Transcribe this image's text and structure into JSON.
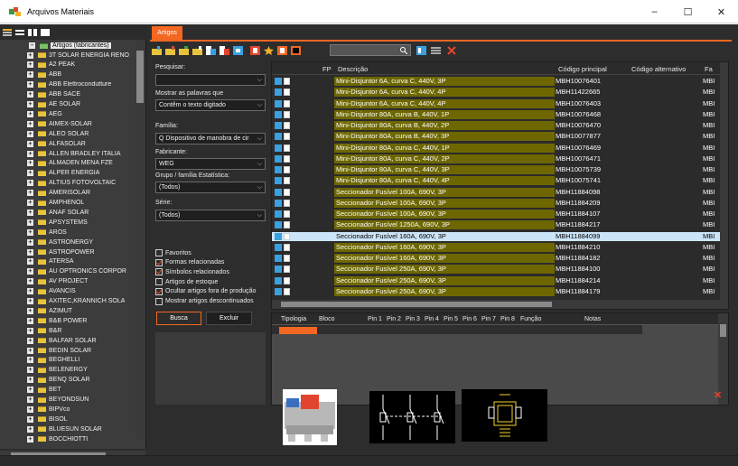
{
  "window": {
    "title": "Arquivos Materiais",
    "minimize": "–",
    "maximize": "☐",
    "close": "✕"
  },
  "tree": {
    "root_label": "Artigos (fabricantes)",
    "items": [
      "3T SOLAR ENERGIA RENO",
      "A2 PEAK",
      "ABB",
      "ABB Elettrocondutture",
      "ABB SACE",
      "AE SOLAR",
      "AEG",
      "AIMEX-SOLAR",
      "ALEO SOLAR",
      "ALFASOLAR",
      "ALLEN BRADLEY ITALIA",
      "ALMADEN MENA FZE",
      "ALPER ENERGIA",
      "ALTIUS FOTOVOLTAIC",
      "AMERISOLAR",
      "AMPHENOL",
      "ANAF SOLAR",
      "APSYSTEMS",
      "AROS",
      "ASTRONERGY",
      "ASTROPOWER",
      "ATERSA",
      "AU OPTRONICS CORPOR",
      "AV PROJECT",
      "AVANCIS",
      "AXITEC,KRANNICH SOLA",
      "AZIMUT",
      "B&B POWER",
      "B&R",
      "BALFAR SOLAR",
      "BEDIN SOLAR",
      "BEGHELLI",
      "BELENERGY",
      "BENQ SOLAR",
      "BET",
      "BEYONDSUN",
      "BIPVco",
      "BISOL",
      "BLUESUN SOLAR",
      "BOCCHIOTTI"
    ],
    "expand_symbol": "+",
    "collapse_symbol": "−"
  },
  "tab": {
    "label": "Artigos"
  },
  "filters": {
    "search_label": "Pesquisar:",
    "search_value": "",
    "words_label": "Mostrar as palavras que",
    "words_value": "Contêm o texto digitado",
    "family_label": "Família:",
    "family_value": "Q Dispositivo de manobra de cir",
    "maker_label": "Fabricante:",
    "maker_value": "WEG",
    "group_label": "Grupo / família Estatística:",
    "group_value": "(Todos)",
    "series_label": "Série:",
    "series_value": "(Todos)",
    "checkboxes": [
      {
        "label": "Favoritos",
        "checked": false
      },
      {
        "label": "Formas relacionadas",
        "checked": true
      },
      {
        "label": "Símbolos relacionados",
        "checked": true
      },
      {
        "label": "Artigos de estoque",
        "checked": false
      },
      {
        "label": "Ocultar artigos fora de produção",
        "checked": true
      },
      {
        "label": "Mostrar artigos descontinuados",
        "checked": false
      }
    ],
    "search_button": "Busca",
    "delete_button": "Excluir"
  },
  "grid": {
    "headers": {
      "fp": "FP",
      "desc": "Descrição",
      "code": "Código principal",
      "alt": "Código alternativo",
      "fa": "Fa"
    },
    "rows": [
      {
        "desc": "Mini-Disjuntor 6A, curva C, 440V, 3P",
        "code": "MBH10076401",
        "fa": "MBI"
      },
      {
        "desc": "Mini-Disjuntor 6A, curva C, 440V, 4P",
        "code": "MBH11422665",
        "fa": "MBI"
      },
      {
        "desc": "Mini-Disjuntor 6A, curva C, 440V, 4P",
        "code": "MBH10076403",
        "fa": "MBI"
      },
      {
        "desc": "Mini-Disjuntor 80A, curva B, 440V, 1P",
        "code": "MBH10076468",
        "fa": "MBI"
      },
      {
        "desc": "Mini-Disjuntor 80A, curva B, 440V, 2P",
        "code": "MBH10076470",
        "fa": "MBI"
      },
      {
        "desc": "Mini-Disjuntor 80A, curva B, 440V, 3P",
        "code": "MBH10077877",
        "fa": "MBI"
      },
      {
        "desc": "Mini-Disjuntor 80A, curva C, 440V, 1P",
        "code": "MBH10076469",
        "fa": "MBI"
      },
      {
        "desc": "Mini-Disjuntor 80A, curva C, 440V, 2P",
        "code": "MBH10076471",
        "fa": "MBI"
      },
      {
        "desc": "Mini-Disjuntor 80A, curva C, 440V, 3P",
        "code": "MBH10075739",
        "fa": "MBI"
      },
      {
        "desc": "Mini-Disjuntor 80A, curva C, 440V, 4P",
        "code": "MBH10075741",
        "fa": "MBI"
      },
      {
        "desc": "Seccionador Fusível 100A, 690V, 3P",
        "code": "MBH11884098",
        "fa": "MBI"
      },
      {
        "desc": "Seccionador Fusível 100A, 690V, 3P",
        "code": "MBH11884209",
        "fa": "MBI"
      },
      {
        "desc": "Seccionador Fusível 100A, 690V, 3P",
        "code": "MBH11884107",
        "fa": "MBI"
      },
      {
        "desc": "Seccionador Fusível 1250A, 690V, 3P",
        "code": "MBH11884217",
        "fa": "MBI"
      },
      {
        "desc": "Seccionador Fusível 160A, 690V, 3P",
        "code": "MBH11884099",
        "fa": "MBI",
        "selected": true
      },
      {
        "desc": "Seccionador Fusível 160A, 690V, 3P",
        "code": "MBH11884210",
        "fa": "MBI"
      },
      {
        "desc": "Seccionador Fusível 160A, 690V, 3P",
        "code": "MBH11884182",
        "fa": "MBI"
      },
      {
        "desc": "Seccionador Fusível 250A, 690V, 3P",
        "code": "MBH11884100",
        "fa": "MBI"
      },
      {
        "desc": "Seccionador Fusível 250A, 690V, 3P",
        "code": "MBH11884214",
        "fa": "MBI"
      },
      {
        "desc": "Seccionador Fusível 250A, 690V, 3P",
        "code": "MBH11884179",
        "fa": "MBI"
      }
    ]
  },
  "lower_grid": {
    "headers": [
      "Tipologia",
      "Bloco",
      "Pin 1",
      "Pin 2",
      "Pin 3",
      "Pin 4",
      "Pin 5",
      "Pin 6",
      "Pin 7",
      "Pin 8",
      "Função",
      "Notas"
    ]
  },
  "colors": {
    "accent": "#f26722",
    "row_highlight": "#6e6700",
    "selection": "#cce4f7",
    "panel": "#2d2d2d"
  }
}
